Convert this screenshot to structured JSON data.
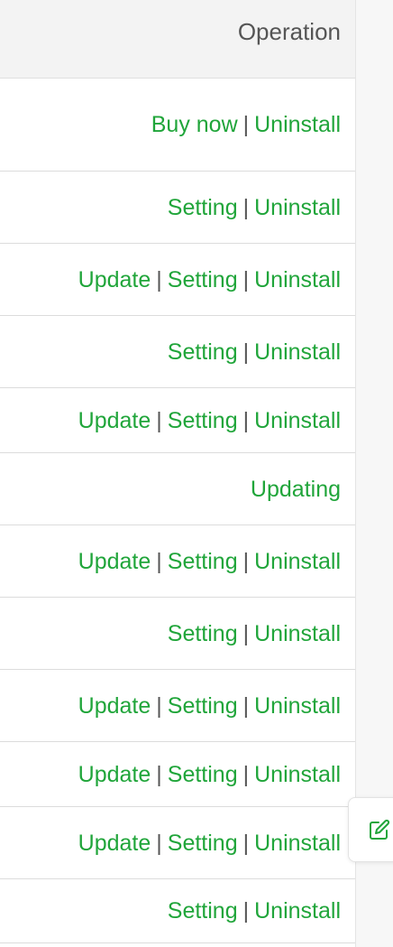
{
  "header": {
    "operation_label": "Operation"
  },
  "separator": "|",
  "colors": {
    "link": "#20a53a",
    "separator": "#555555",
    "header_bg": "#f3f3f3"
  },
  "float_button": {
    "icon": "edit-icon"
  },
  "rows": [
    {
      "actions": [
        "Buy now",
        "Uninstall"
      ]
    },
    {
      "actions": [
        "Setting",
        "Uninstall"
      ]
    },
    {
      "actions": [
        "Update",
        "Setting",
        "Uninstall"
      ]
    },
    {
      "actions": [
        "Setting",
        "Uninstall"
      ]
    },
    {
      "actions": [
        "Update",
        "Setting",
        "Uninstall"
      ]
    },
    {
      "actions": [
        "Updating"
      ]
    },
    {
      "actions": [
        "Update",
        "Setting",
        "Uninstall"
      ]
    },
    {
      "actions": [
        "Setting",
        "Uninstall"
      ]
    },
    {
      "actions": [
        "Update",
        "Setting",
        "Uninstall"
      ]
    },
    {
      "actions": [
        "Update",
        "Setting",
        "Uninstall"
      ]
    },
    {
      "actions": [
        "Update",
        "Setting",
        "Uninstall"
      ]
    },
    {
      "actions": [
        "Setting",
        "Uninstall"
      ]
    }
  ]
}
